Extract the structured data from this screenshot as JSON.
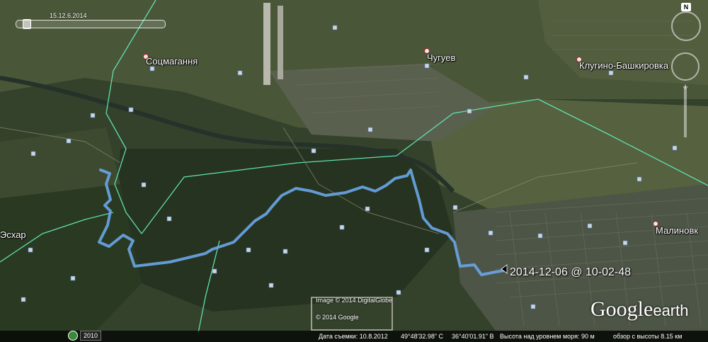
{
  "places": {
    "sotsmagannia": "Соцмагання",
    "chuguev": "Чугуев",
    "klugino": "Клугино-Башкировка",
    "eskhar": "Эсхар",
    "malinovka": "Малиновк"
  },
  "track": {
    "label": "2014-12-06 @ 10-02-48",
    "color": "#6aa6e8"
  },
  "time_slider": {
    "date": "15.12.6.2014"
  },
  "logo": {
    "word": "Google",
    "sub": "earth"
  },
  "credits": {
    "line1": "Image © 2014 DigitalGlobe",
    "line2": "© 2014 Google"
  },
  "year_badge": {
    "year": "2010"
  },
  "status": {
    "date": "Дата съемки: 10.8.2012",
    "lat": "49°48'32.98\" С",
    "lon": "36°40'01.91\" В",
    "elevation": "Высота над уровнем моря:   90 м",
    "eye_alt": "обзор с высоты   8.15 км"
  },
  "compass": {
    "north": "N"
  },
  "colors": {
    "border_line": "#5fe0b0",
    "satellite_base": "#2d3a24"
  }
}
